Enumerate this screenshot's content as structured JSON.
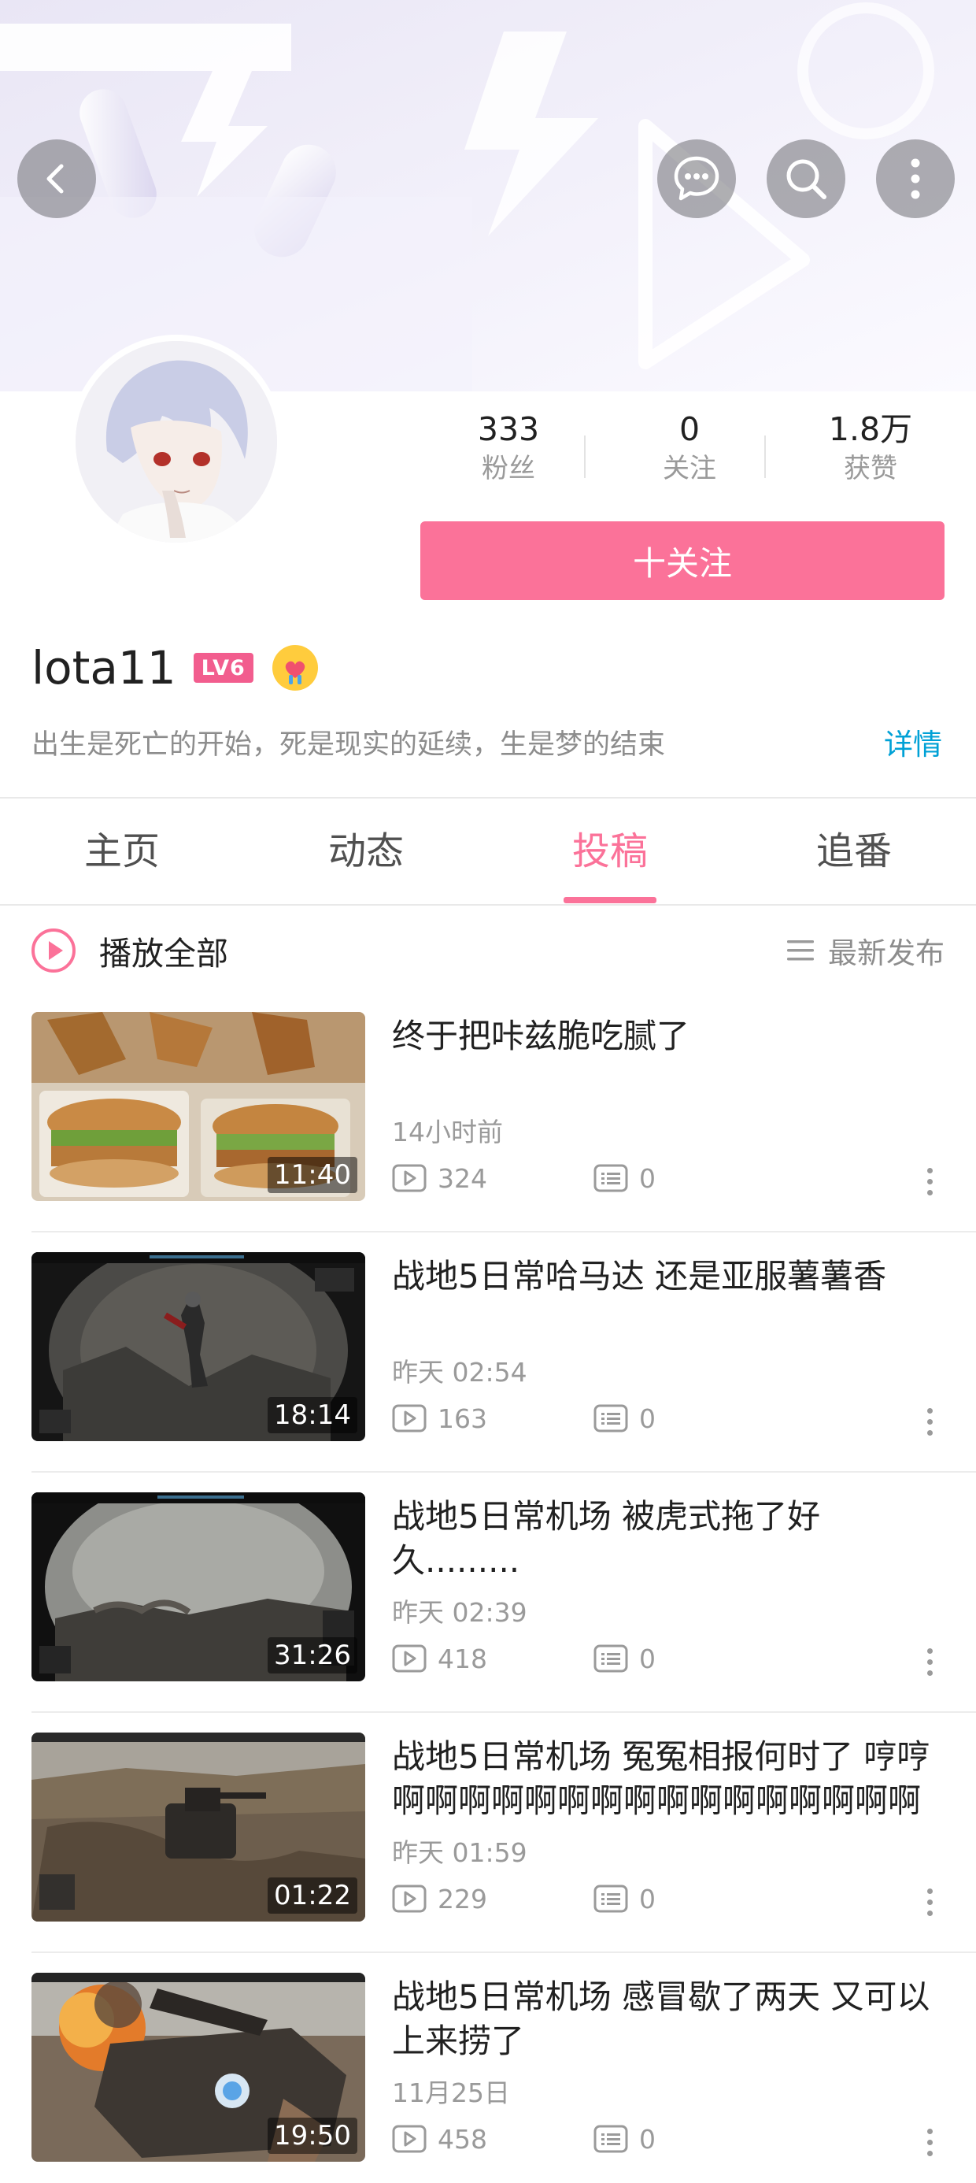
{
  "header": {
    "back_icon": "back-arrow-icon",
    "message_icon": "message-bubble-icon",
    "search_icon": "search-icon",
    "more_icon": "vertical-dots-icon"
  },
  "profile": {
    "username": "lota11",
    "level": "LV6",
    "bio": "出生是死亡的开始，死是现实的延续，生是梦的结束",
    "detail_label": "详情",
    "follow_label": "十关注",
    "stats": [
      {
        "value": "333",
        "label": "粉丝"
      },
      {
        "value": "0",
        "label": "关注"
      },
      {
        "value": "1.8万",
        "label": "获赞"
      }
    ]
  },
  "tabs": [
    {
      "label": "主页"
    },
    {
      "label": "动态"
    },
    {
      "label": "投稿"
    },
    {
      "label": "追番"
    }
  ],
  "toolbar": {
    "play_all_label": "播放全部",
    "sort_label": "最新发布"
  },
  "videos": [
    {
      "title": "终于把咔兹脆吃腻了",
      "date": "14小时前",
      "plays": "324",
      "comments": "0",
      "duration": "11:40"
    },
    {
      "title": "战地5日常哈马达 还是亚服薯薯香",
      "date": "昨天 02:54",
      "plays": "163",
      "comments": "0",
      "duration": "18:14"
    },
    {
      "title": "战地5日常机场 被虎式拖了好久.........",
      "date": "昨天 02:39",
      "plays": "418",
      "comments": "0",
      "duration": "31:26"
    },
    {
      "title": "战地5日常机场 冤冤相报何时了 哼哼 啊啊啊啊啊啊啊啊啊啊啊啊啊啊啊啊",
      "date": "昨天 01:59",
      "plays": "229",
      "comments": "0",
      "duration": "01:22"
    },
    {
      "title": "战地5日常机场 感冒歇了两天 又可以上来捞了",
      "date": "11月25日",
      "plays": "458",
      "comments": "0",
      "duration": "19:50"
    }
  ],
  "colors": {
    "accent": "#fb7299",
    "link": "#00a1d6",
    "level_badge": "#f25d8e"
  }
}
